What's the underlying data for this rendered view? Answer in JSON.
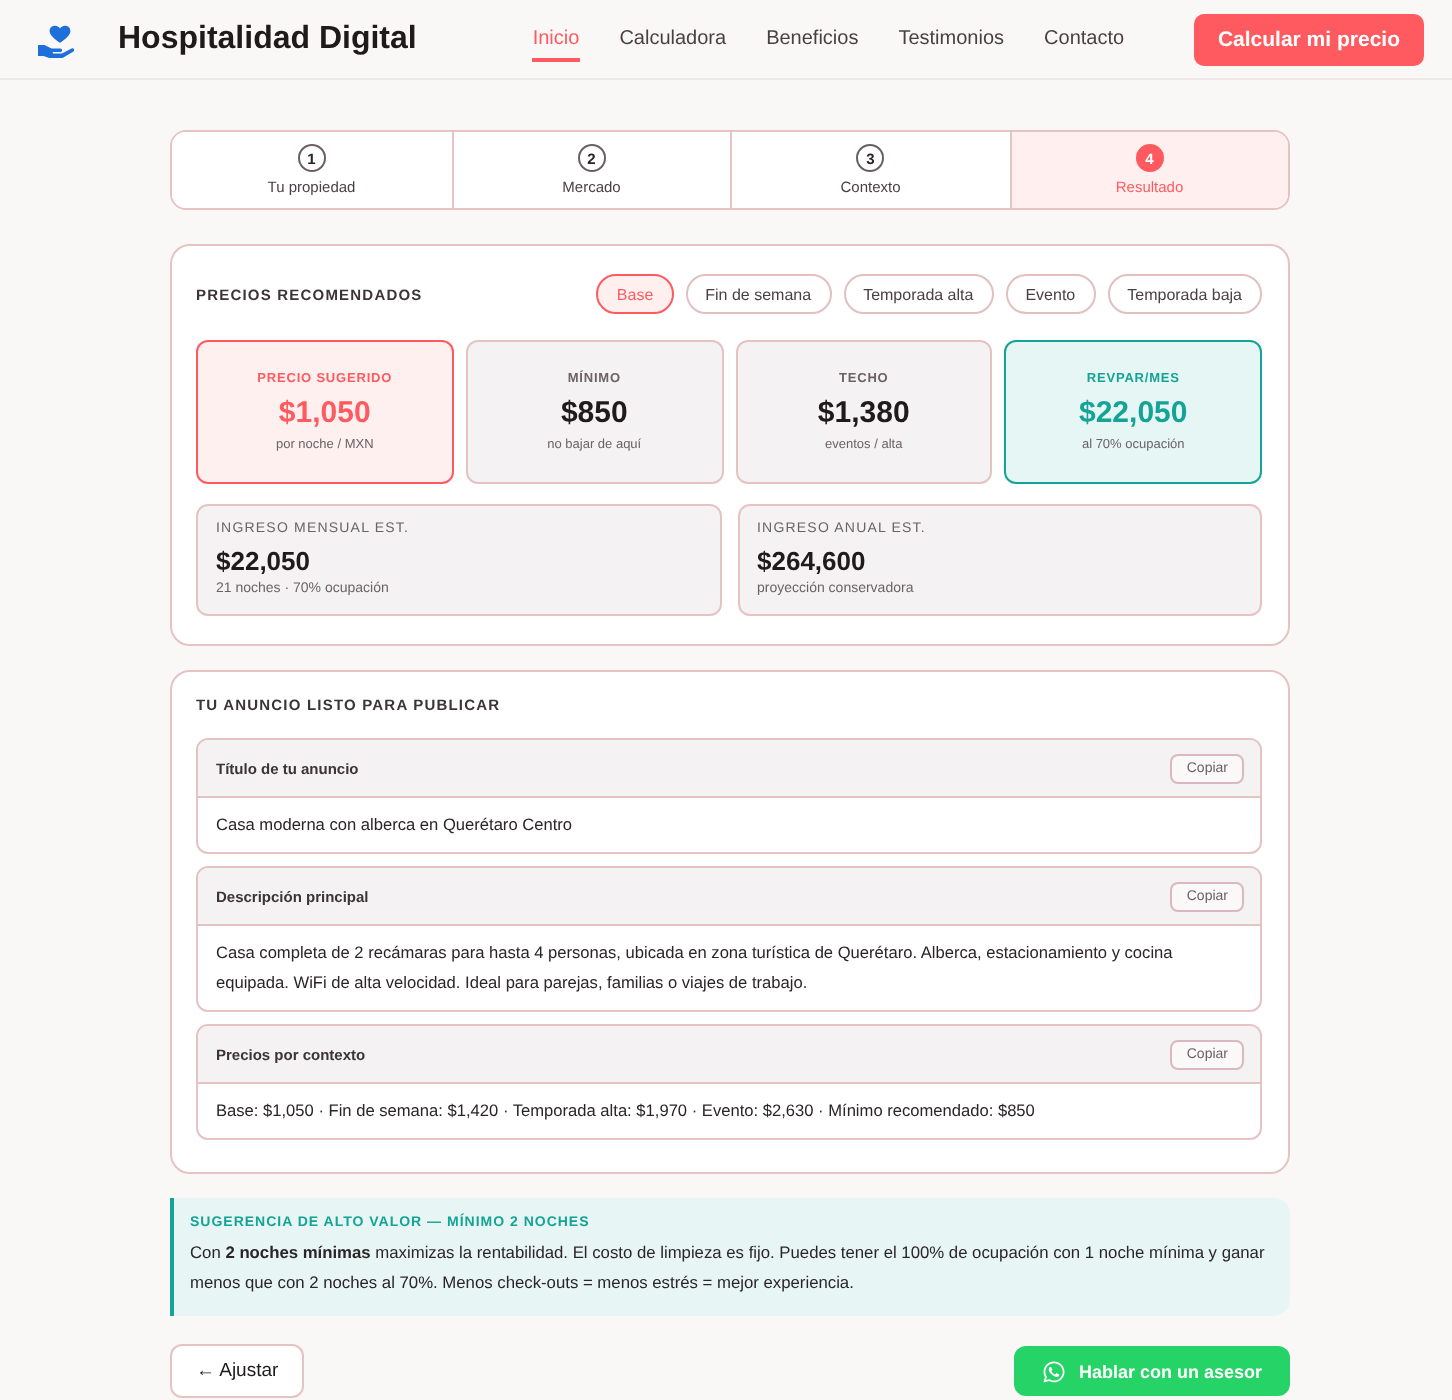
{
  "header": {
    "brand": "Hospitalidad Digital",
    "nav": [
      {
        "label": "Inicio",
        "selected": true
      },
      {
        "label": "Calculadora",
        "selected": false
      },
      {
        "label": "Beneficios",
        "selected": false
      },
      {
        "label": "Testimonios",
        "selected": false
      },
      {
        "label": "Contacto",
        "selected": false
      }
    ],
    "cta": "Calcular mi precio"
  },
  "steps": [
    {
      "number": "1",
      "label": "Tu propiedad",
      "selected": false
    },
    {
      "number": "2",
      "label": "Mercado",
      "selected": false
    },
    {
      "number": "3",
      "label": "Contexto",
      "selected": false
    },
    {
      "number": "4",
      "label": "Resultado",
      "selected": true
    }
  ],
  "pricing": {
    "title": "PRECIOS RECOMENDADOS",
    "filters": [
      {
        "label": "Base",
        "selected": true
      },
      {
        "label": "Fin de semana",
        "selected": false
      },
      {
        "label": "Temporada alta",
        "selected": false
      },
      {
        "label": "Evento",
        "selected": false
      },
      {
        "label": "Temporada baja",
        "selected": false
      }
    ],
    "stats": [
      {
        "kind": "primary",
        "label": "PRECIO SUGERIDO",
        "value": "$1,050",
        "note": "por noche / MXN"
      },
      {
        "kind": "neutral",
        "label": "MÍNIMO",
        "value": "$850",
        "note": "no bajar de aquí"
      },
      {
        "kind": "neutral",
        "label": "TECHO",
        "value": "$1,380",
        "note": "eventos / alta"
      },
      {
        "kind": "accent",
        "label": "REVPAR/MES",
        "value": "$22,050",
        "note": "al 70% ocupación"
      }
    ],
    "income": [
      {
        "label": "INGRESO MENSUAL EST.",
        "value": "$22,050",
        "note": "21 noches · 70% ocupación"
      },
      {
        "label": "INGRESO ANUAL EST.",
        "value": "$264,600",
        "note": "proyección conservadora"
      }
    ]
  },
  "listing": {
    "title": "TU ANUNCIO LISTO PARA PUBLICAR",
    "sections": [
      {
        "title": "Título de tu anuncio",
        "button": "Copiar",
        "text": "Casa moderna con alberca en Querétaro Centro"
      },
      {
        "title": "Descripción principal",
        "button": "Copiar",
        "text": "Casa completa de 2 recámaras para hasta 4 personas, ubicada en zona turística de Querétaro. Alberca, estacionamiento y cocina equipada. WiFi de alta velocidad. Ideal para parejas, familias o viajes de trabajo."
      },
      {
        "title": "Precios por contexto",
        "button": "Copiar",
        "text": "Base: $1,050 · Fin de semana: $1,420 · Temporada alta: $1,970 · Evento: $2,630 · Mínimo recomendado: $850"
      }
    ]
  },
  "tip": {
    "title": "SUGERENCIA DE ALTO VALOR — MÍNIMO 2 NOCHES",
    "text": "Con **2 noches mínimas** maximizas la rentabilidad. El costo de limpieza es fijo. Puedes tener el 100% de ocupación con 1 noche mínima y ganar menos que con 2 noches al 70%. Menos check-outs = menos estrés = mejor experiencia."
  },
  "actions": {
    "back": "← Ajustar",
    "contact": "Hablar con un asesor"
  }
}
